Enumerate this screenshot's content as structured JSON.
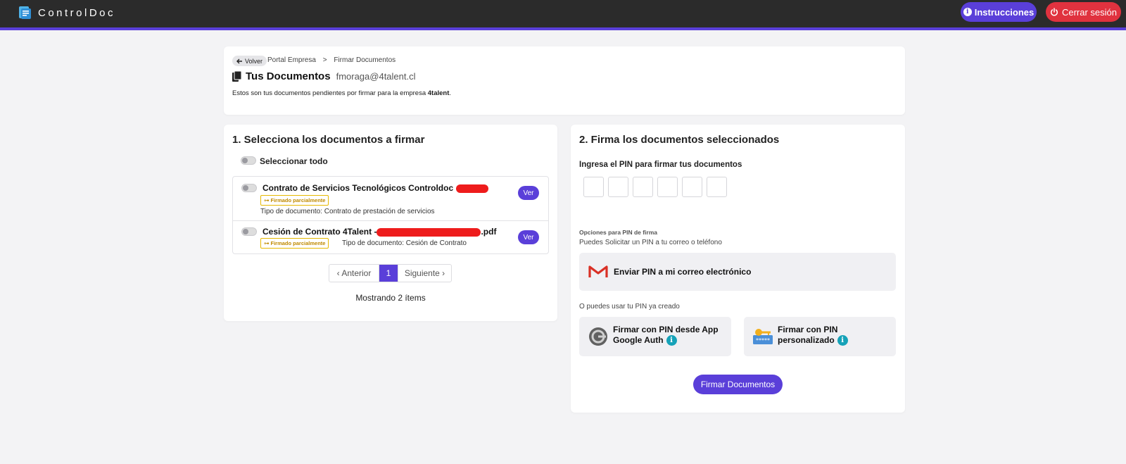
{
  "app": {
    "name": "ControlDoc"
  },
  "topbar": {
    "instructions_label": "Instrucciones",
    "logout_label": "Cerrar sesión",
    "accent": "#5a3fd9",
    "logout_color": "#e0323f"
  },
  "header": {
    "back_label": "Volver",
    "breadcrumb": [
      "Portal Empresa",
      ">",
      "Firmar Documentos"
    ],
    "title": "Tus Documentos",
    "email": "fmoraga@4talent.cl",
    "subtitle_prefix": "Estos son tus documentos pendientes por firmar para la empresa",
    "company": "4talent",
    "subtitle_suffix": "."
  },
  "select_section": {
    "title": "1. Selecciona los documentos a firmar",
    "select_all_label": "Seleccionar todo",
    "documents": [
      {
        "name": "Contrato de Servicios Tecnológicos Controldoc",
        "name_suffix": "",
        "status": "Firmado parcialmente",
        "type": "Tipo de documento: Contrato de prestación de servicios",
        "view_label": "Ver"
      },
      {
        "name": "Cesión de Contrato 4Talent -",
        "name_suffix": ".pdf",
        "status": "Firmado parcialmente",
        "type": "Tipo de documento: Cesión de Contrato",
        "view_label": "Ver"
      }
    ],
    "pagination": {
      "prev": "‹ Anterior",
      "current": "1",
      "next": "Siguiente ›"
    },
    "showing": "Mostrando 2 ítems"
  },
  "sign_section": {
    "title": "2. Firma los documentos seleccionados",
    "pin_label": "Ingresa el PIN para firmar tus documentos",
    "pin_digits": [
      "",
      "",
      "",
      "",
      "",
      ""
    ],
    "options_title": "Opciones para PIN de firma",
    "options_sub": "Puedes Solicitar un PIN a tu correo o teléfono",
    "email_option": "Enviar PIN a mi correo electrónico",
    "alt_text": "O puedes usar tu PIN ya creado",
    "ga_option_line1": "Firmar con PIN desde App",
    "ga_option_line2": "Google Auth",
    "custom_option_line1": "Firmar con PIN",
    "custom_option_line2": "personalizado",
    "sign_button": "Firmar Documentos"
  }
}
